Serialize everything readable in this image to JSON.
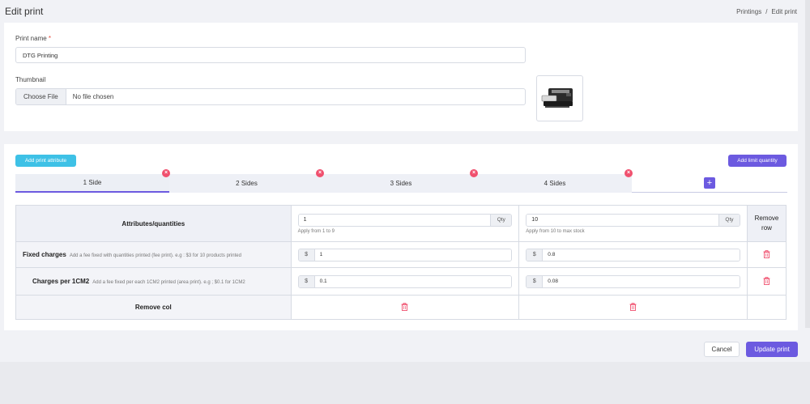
{
  "header": {
    "title": "Edit print",
    "breadcrumb": [
      "Printings",
      "Edit print"
    ],
    "breadcrumb_sep": "/"
  },
  "form": {
    "print_name_label": "Print name",
    "required_mark": "*",
    "print_name_value": "DTG Printing",
    "thumbnail_label": "Thumbnail",
    "choose_file_label": "Choose File",
    "no_file_text": "No file chosen"
  },
  "buttons": {
    "add_print_attribute": "Add print attribute",
    "add_limit_quantity": "Add limit quantity",
    "cancel": "Cancel",
    "update_print": "Update print"
  },
  "tabs": [
    {
      "label": "1 Side",
      "active": true
    },
    {
      "label": "2 Sides",
      "active": false
    },
    {
      "label": "3 Sides",
      "active": false
    },
    {
      "label": "4 Sides",
      "active": false
    }
  ],
  "tab_add_symbol": "+",
  "tab_close_symbol": "×",
  "table": {
    "header_label": "Attributes/quantities",
    "remove_row_header": "Remove row",
    "columns": [
      {
        "qty": "1",
        "qty_suffix": "Qty",
        "apply": "Apply from 1 to 9"
      },
      {
        "qty": "10",
        "qty_suffix": "Qty",
        "apply": "Apply from 10 to max stock"
      }
    ],
    "rows": [
      {
        "title": "Fixed charges",
        "desc": "Add a fee fixed with quantities printed (fee print). e.g : $3 for 10 products printed",
        "prefix": "$",
        "values": [
          "1",
          "0.8"
        ]
      },
      {
        "title": "Charges per 1CM2",
        "desc": "Add a fee fixed per each 1CM2 printed (area print). e.g ; $0.1 for 1CM2",
        "prefix": "$",
        "values": [
          "0.1",
          "0.08"
        ]
      }
    ],
    "remove_col_label": "Remove col"
  },
  "colors": {
    "accent": "#6c5ae0",
    "cyan": "#3ec1e6",
    "danger": "#f0506e"
  }
}
